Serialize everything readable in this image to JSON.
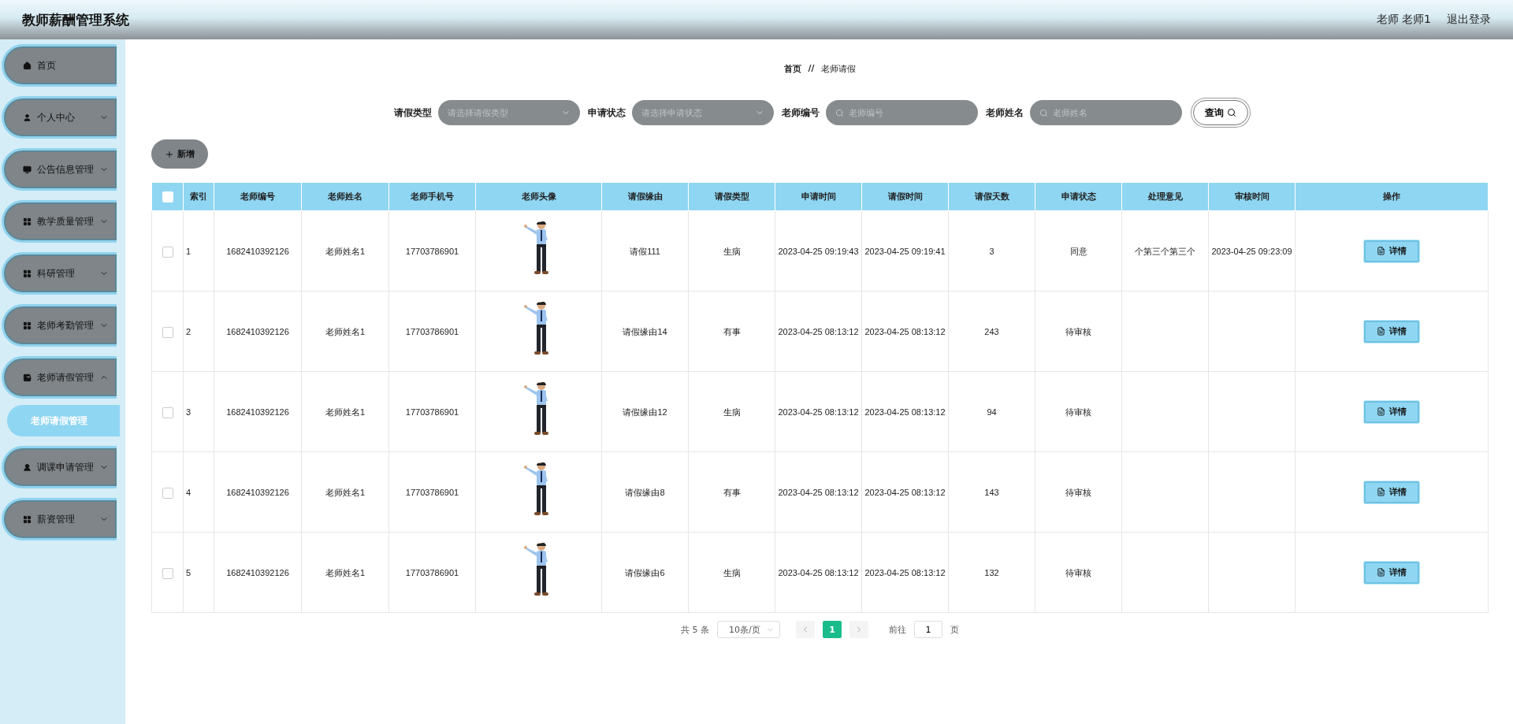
{
  "header": {
    "title": "教师薪酬管理系统",
    "user": "老师 老师1",
    "logout": "退出登录"
  },
  "sidebar": {
    "items": [
      {
        "label": "首页"
      },
      {
        "label": "个人中心",
        "expanded": false
      },
      {
        "label": "公告信息管理",
        "expanded": false
      },
      {
        "label": "教学质量管理",
        "expanded": false
      },
      {
        "label": "科研管理",
        "expanded": false
      },
      {
        "label": "老师考勤管理",
        "expanded": false
      },
      {
        "label": "老师请假管理",
        "expanded": true,
        "children": [
          {
            "label": "老师请假管理",
            "selected": true
          }
        ]
      },
      {
        "label": "调课申请管理",
        "expanded": false
      },
      {
        "label": "薪资管理",
        "expanded": false
      }
    ]
  },
  "breadcrumb": {
    "items": [
      "首页",
      "老师请假"
    ],
    "separator": "//"
  },
  "search": {
    "fields": [
      {
        "label": "请假类型",
        "placeholder": "请选择请假类型",
        "kind": "select"
      },
      {
        "label": "申请状态",
        "placeholder": "请选择申请状态",
        "kind": "select"
      },
      {
        "label": "老师编号",
        "placeholder": "老师编号",
        "kind": "input"
      },
      {
        "label": "老师姓名",
        "placeholder": "老师姓名",
        "kind": "input"
      }
    ],
    "button": "查询"
  },
  "add_button": "新增",
  "table": {
    "all_checked": false,
    "columns": [
      "索引",
      "老师编号",
      "老师姓名",
      "老师手机号",
      "老师头像",
      "请假缘由",
      "请假类型",
      "申请时间",
      "请假时间",
      "请假天数",
      "申请状态",
      "处理意见",
      "审核时间",
      "操作"
    ],
    "rows": [
      {
        "checked": false,
        "index": "1",
        "teacher_no": "1682410392126",
        "teacher_name": "老师姓名1",
        "phone": "17703786901",
        "reason": "请假111",
        "leave_type": "生病",
        "apply_time": "2023-04-25 09:19:43",
        "leave_time": "2023-04-25 09:19:41",
        "days": "3",
        "status": "同意",
        "opinion": "个第三个第三个",
        "review_time": "2023-04-25 09:23:09",
        "action": "详情"
      },
      {
        "checked": false,
        "index": "2",
        "teacher_no": "1682410392126",
        "teacher_name": "老师姓名1",
        "phone": "17703786901",
        "reason": "请假缘由14",
        "leave_type": "有事",
        "apply_time": "2023-04-25 08:13:12",
        "leave_time": "2023-04-25 08:13:12",
        "days": "243",
        "status": "待审核",
        "action": "详情"
      },
      {
        "checked": false,
        "index": "3",
        "teacher_no": "1682410392126",
        "teacher_name": "老师姓名1",
        "phone": "17703786901",
        "reason": "请假缘由12",
        "leave_type": "生病",
        "apply_time": "2023-04-25 08:13:12",
        "leave_time": "2023-04-25 08:13:12",
        "days": "94",
        "status": "待审核",
        "action": "详情"
      },
      {
        "checked": false,
        "index": "4",
        "teacher_no": "1682410392126",
        "teacher_name": "老师姓名1",
        "phone": "17703786901",
        "reason": "请假缘由8",
        "leave_type": "有事",
        "apply_time": "2023-04-25 08:13:12",
        "leave_time": "2023-04-25 08:13:12",
        "days": "143",
        "status": "待审核",
        "action": "详情"
      },
      {
        "checked": false,
        "index": "5",
        "teacher_no": "1682410392126",
        "teacher_name": "老师姓名1",
        "phone": "17703786901",
        "reason": "请假缘由6",
        "leave_type": "生病",
        "apply_time": "2023-04-25 08:13:12",
        "leave_time": "2023-04-25 08:13:12",
        "days": "132",
        "status": "待审核",
        "action": "详情"
      }
    ]
  },
  "pagination": {
    "total": "共 5 条",
    "page_size": "10条/页",
    "pages": [
      {
        "label": "1",
        "selected": true
      }
    ],
    "goto_label": "前往",
    "goto_value": "1",
    "page_suffix": "页"
  }
}
